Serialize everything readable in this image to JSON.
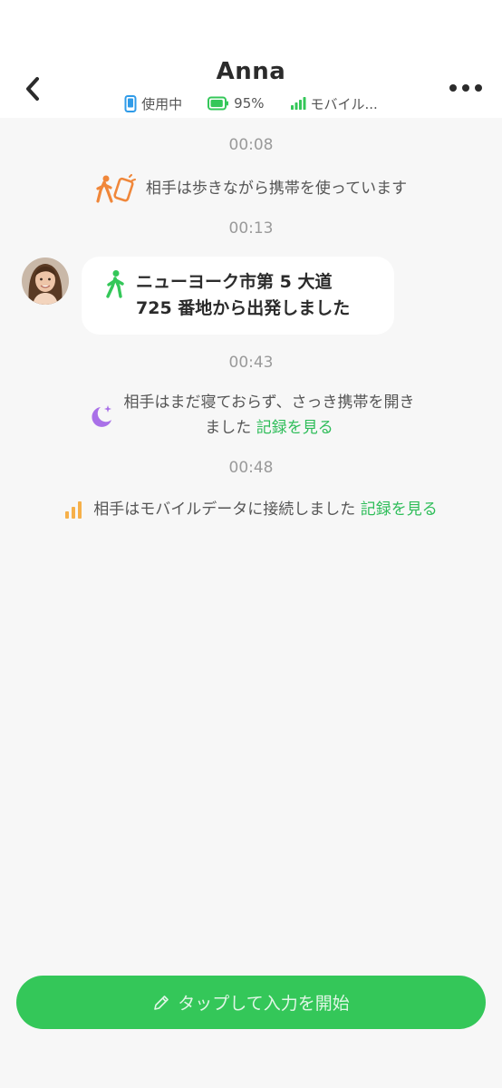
{
  "header": {
    "title": "Anna",
    "status": {
      "device": "使用中",
      "battery": "95%",
      "battery_level": 0.95,
      "network": "モバイル..."
    }
  },
  "timeline": [
    {
      "time": "00:08",
      "event": "相手は歩きながら携帯を使っています"
    },
    {
      "time": "00:13",
      "message": "ニューヨーク市第 5 大道\n725 番地から出発しました"
    },
    {
      "time": "00:43",
      "event_line1": "相手はまだ寝ておらず、さっき携帯を開き",
      "event_line2": "ました",
      "link": "記録を見る"
    },
    {
      "time": "00:48",
      "event": "相手はモバイルデータに接続しました",
      "link": "記録を見る"
    }
  ],
  "input_button": {
    "label": "タップして入力を開始"
  },
  "colors": {
    "accent_green": "#34c759",
    "link_green": "#2ebd59",
    "walking_orange": "#f0873a",
    "moon_purple": "#a970e8",
    "signal_orange": "#f6b04a",
    "device_blue": "#2f9be8"
  }
}
